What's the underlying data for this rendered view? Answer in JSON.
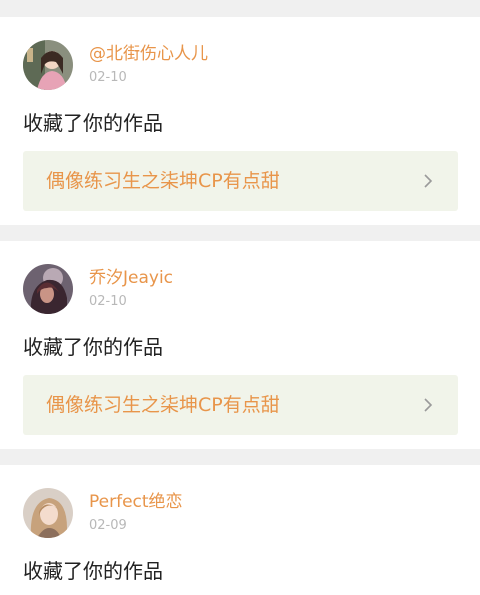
{
  "feed": {
    "items": [
      {
        "username": "@北街伤心人儿",
        "date": "02-10",
        "action": "收藏了你的作品",
        "work_title": "偶像练习生之柒坤CP有点甜",
        "avatar": "avatar-girl-pink-outfit"
      },
      {
        "username": "乔汐Jeayic",
        "date": "02-10",
        "action": "收藏了你的作品",
        "work_title": "偶像练习生之柒坤CP有点甜",
        "avatar": "avatar-dark-hair"
      },
      {
        "username": "Perfect绝恋",
        "date": "02-09",
        "action": "收藏了你的作品",
        "avatar": "avatar-blonde-girl"
      }
    ]
  },
  "colors": {
    "accent": "#e8954a",
    "link_background": "#f1f4ea",
    "page_background": "#f0f0f0",
    "date_gray": "#b8b8b8"
  },
  "icons": {
    "chevron": "chevron-right-icon"
  }
}
